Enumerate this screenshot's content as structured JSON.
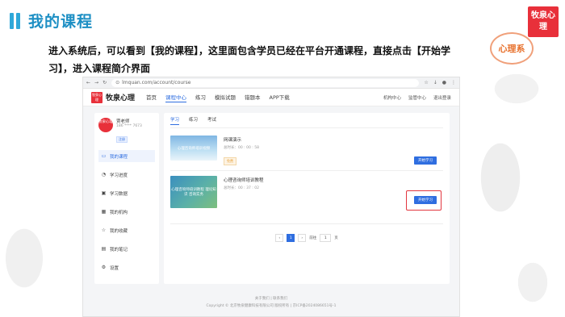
{
  "slide": {
    "title": "我的课程",
    "description": "进入系统后，可以看到【我的课程】，这里面包含学员已经在平台开通课程，直接点击【开始学习】，进入课程简介界面",
    "badge_text": "牧泉心理",
    "seal_text": "心理系"
  },
  "browser": {
    "url": "lmquan.com/account/course"
  },
  "site": {
    "logo_box_text": "牧泉心理",
    "logo_text": "牧泉心理",
    "nav": [
      "首页",
      "课程中心",
      "练习",
      "模拟试题",
      "错题本",
      "APP下载"
    ],
    "nav_active_index": 1,
    "user_links": [
      "机构中心",
      "监管中心",
      "退出登录"
    ]
  },
  "profile": {
    "avatar_text": "牧泉心理",
    "name": "贾老师",
    "phone": "186 **** 7673",
    "badge": "注册"
  },
  "sidebar": {
    "items": [
      {
        "label": "我的课程",
        "icon": "monitor-icon",
        "active": true
      },
      {
        "label": "学习进度",
        "icon": "progress-icon"
      },
      {
        "label": "学习数据",
        "icon": "data-icon"
      },
      {
        "label": "我的机构",
        "icon": "building-icon"
      },
      {
        "label": "我的收藏",
        "icon": "star-icon"
      },
      {
        "label": "我的笔记",
        "icon": "note-icon"
      },
      {
        "label": "设置",
        "icon": "settings-icon"
      }
    ]
  },
  "tabs": [
    "学习",
    "练习",
    "考试"
  ],
  "courses": [
    {
      "title": "网课演示",
      "duration": "总时长：00 : 00 : 58",
      "tag": "免费",
      "button": "开始学习",
      "thumb_text": "心理咨询师培训视频"
    },
    {
      "title": "心理咨询师培训教程",
      "duration": "总时长：00 : 37 : 02",
      "button": "开始学习",
      "thumb_text": "心理咨询师培训教程 理论知识 咨询实务"
    }
  ],
  "pager": {
    "prev": "‹",
    "current": "1",
    "next": "›",
    "goto_label": "前往",
    "goto_value": "1",
    "page_unit": "页"
  },
  "footer": {
    "line1": "关于我们 | 联系我们",
    "line2": "Copyright © 北京牧泉健康科技有限公司 版权所有 | 京ICP备2024086651号-1"
  },
  "colors": {
    "accent": "#2f6ee0",
    "brand_red": "#e8303a",
    "title_blue": "#1d8fc4"
  }
}
